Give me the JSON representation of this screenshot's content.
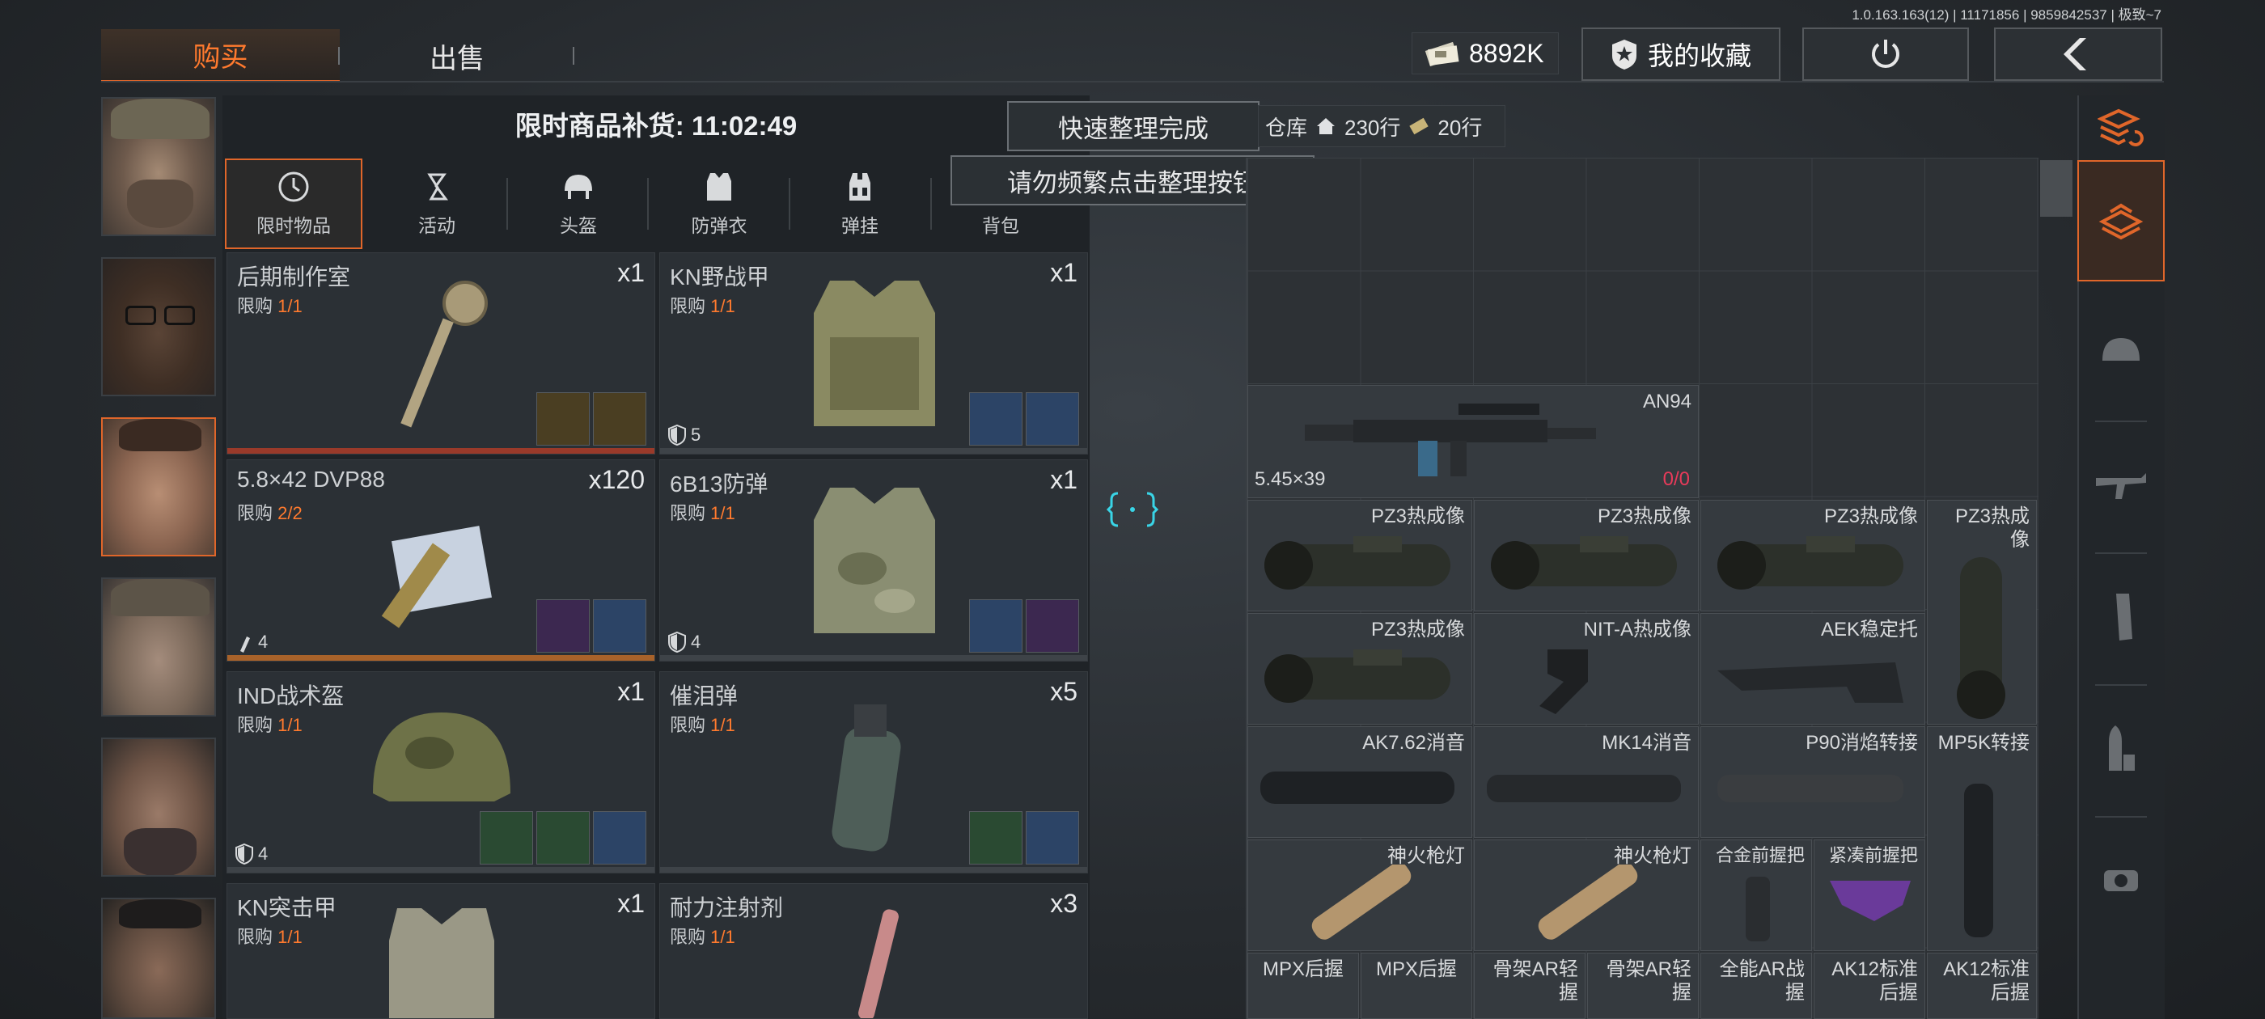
{
  "version": "1.0.163.163(12) | 11171856 | 9859842537 | 极致~7",
  "tabs": {
    "buy": "购买",
    "sell": "出售"
  },
  "header": {
    "money": "8892K",
    "favorites": "我的收藏"
  },
  "restock": "限时商品补货: 11:02:49",
  "toasts": {
    "sort_done": "快速整理完成",
    "warning": "请勿频繁点击整理按钮"
  },
  "categories": [
    {
      "label": "限时物品",
      "icon": "clock-icon"
    },
    {
      "label": "活动",
      "icon": "event-icon"
    },
    {
      "label": "头盔",
      "icon": "helmet-icon"
    },
    {
      "label": "防弹衣",
      "icon": "vest-icon"
    },
    {
      "label": "弹挂",
      "icon": "rig-icon"
    },
    {
      "label": "背包",
      "icon": "backpack-icon"
    }
  ],
  "limit_label": "限购",
  "shop_items": [
    {
      "name": "后期制作室",
      "qty": "x1",
      "limit": "1/1",
      "armor": ""
    },
    {
      "name": "KN野战甲",
      "qty": "x1",
      "limit": "1/1",
      "armor": "5"
    },
    {
      "name": "5.8×42 DVP88",
      "qty": "x120",
      "limit": "2/2",
      "armor": "4"
    },
    {
      "name": "6B13防弹",
      "qty": "x1",
      "limit": "1/1",
      "armor": "4"
    },
    {
      "name": "IND战术盔",
      "qty": "x1",
      "limit": "1/1",
      "armor": "4"
    },
    {
      "name": "催泪弹",
      "qty": "x5",
      "limit": "1/1",
      "armor": ""
    },
    {
      "name": "KN突击甲",
      "qty": "x1",
      "limit": "1/1",
      "armor": ""
    },
    {
      "name": "耐力注射剂",
      "qty": "x3",
      "limit": "1/1",
      "armor": ""
    }
  ],
  "warehouse": {
    "label": "仓库",
    "home_rows": "230行",
    "extra_rows": "20行"
  },
  "inventory": {
    "an94": {
      "name": "AN94",
      "ammo": "5.45×39",
      "dur_a": "0",
      "dur_b": "0"
    },
    "scopes": [
      "PZ3热成像",
      "PZ3热成像",
      "PZ3热成像",
      "PZ3热成像",
      "PZ3热成像",
      "NIT-A热成像",
      "AEK稳定托"
    ],
    "muzzles": [
      "AK7.62消音",
      "MK14消音",
      "P90消焰转接",
      "MP5K转接"
    ],
    "lights": [
      "神火枪灯",
      "神火枪灯",
      "合金前握把",
      "紧凑前握把"
    ],
    "bottom": [
      "MPX后握",
      "MPX后握",
      "骨架AR轻握",
      "骨架AR轻握",
      "全能AR战握",
      "AK12标准后握",
      "AK12标准后握"
    ]
  },
  "colors": {
    "accent": "#e0662a",
    "limit": "#ff7a2e",
    "durability": "#e83a5a",
    "cyan": "#39d4e6"
  }
}
